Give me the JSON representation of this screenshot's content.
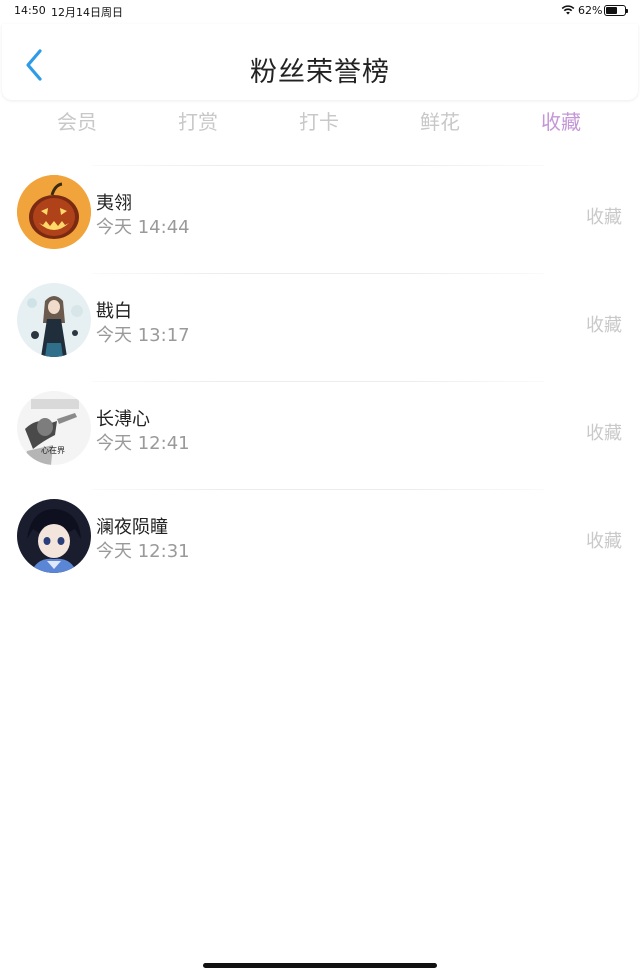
{
  "status_bar": {
    "time": "14:50",
    "date": "12月14日周日",
    "battery_percent": "62%",
    "battery_level": 0.62
  },
  "header": {
    "title": "粉丝荣誉榜",
    "back_icon": "chevron-left-icon",
    "accent_color": "#2d9be8"
  },
  "tabs": [
    {
      "label": "会员",
      "active": false
    },
    {
      "label": "打赏",
      "active": false
    },
    {
      "label": "打卡",
      "active": false
    },
    {
      "label": "鲜花",
      "active": false
    },
    {
      "label": "收藏",
      "active": true
    }
  ],
  "active_tab_color": "#c497d8",
  "fans": [
    {
      "name": "夷翎",
      "time": "今天 14:44",
      "action": "收藏",
      "avatar": "pumpkin-avatar"
    },
    {
      "name": "戡白",
      "time": "今天 13:17",
      "action": "收藏",
      "avatar": "girl-avatar"
    },
    {
      "name": "长溥心",
      "time": "今天 12:41",
      "action": "收藏",
      "avatar": "sketch-avatar"
    },
    {
      "name": "澜夜陨瞳",
      "time": "今天 12:31",
      "action": "收藏",
      "avatar": "anime-boy-avatar"
    }
  ]
}
